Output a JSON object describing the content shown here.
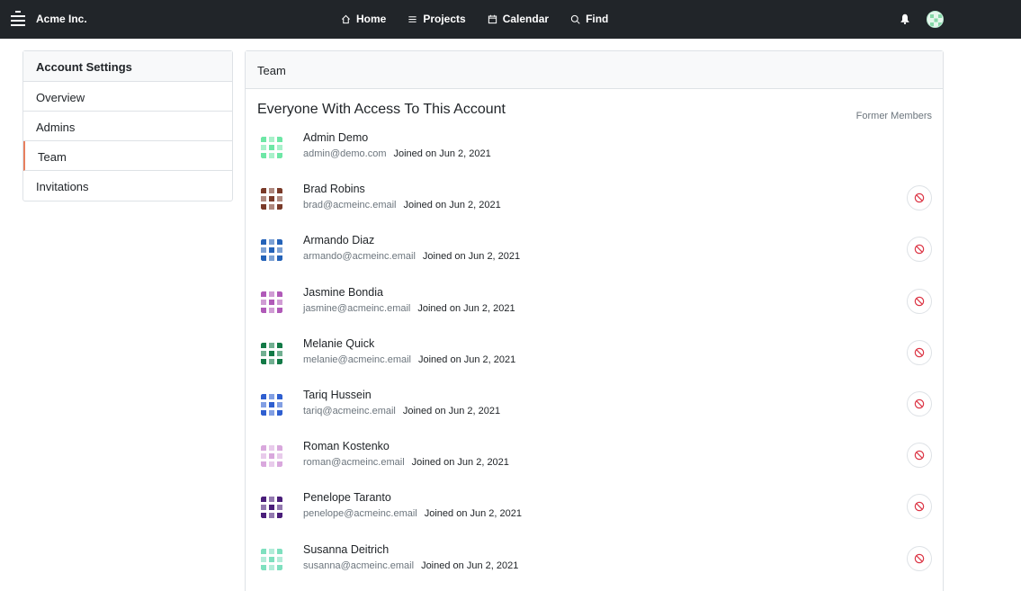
{
  "navbar": {
    "brand": "Acme Inc.",
    "links": [
      {
        "label": "Home",
        "icon": "home-icon"
      },
      {
        "label": "Projects",
        "icon": "list-icon"
      },
      {
        "label": "Calendar",
        "icon": "calendar-icon"
      },
      {
        "label": "Find",
        "icon": "search-icon"
      }
    ]
  },
  "sidebar": {
    "title": "Account Settings",
    "items": [
      {
        "label": "Overview"
      },
      {
        "label": "Admins"
      },
      {
        "label": "Team",
        "active": true
      },
      {
        "label": "Invitations"
      }
    ]
  },
  "main": {
    "card_title": "Team",
    "section_title": "Everyone With Access To This Account",
    "former_members_link": "Former Members",
    "members": [
      {
        "name": "Admin Demo",
        "email": "admin@demo.com",
        "joined": "Joined on Jun 2, 2021",
        "color": "#6ee7a6",
        "revocable": false
      },
      {
        "name": "Brad Robins",
        "email": "brad@acmeinc.email",
        "joined": "Joined on Jun 2, 2021",
        "color": "#7a3b2a",
        "revocable": true
      },
      {
        "name": "Armando Diaz",
        "email": "armando@acmeinc.email",
        "joined": "Joined on Jun 2, 2021",
        "color": "#2563b8",
        "revocable": true
      },
      {
        "name": "Jasmine Bondia",
        "email": "jasmine@acmeinc.email",
        "joined": "Joined on Jun 2, 2021",
        "color": "#b05ab8",
        "revocable": true
      },
      {
        "name": "Melanie Quick",
        "email": "melanie@acmeinc.email",
        "joined": "Joined on Jun 2, 2021",
        "color": "#137a47",
        "revocable": true
      },
      {
        "name": "Tariq Hussein",
        "email": "tariq@acmeinc.email",
        "joined": "Joined on Jun 2, 2021",
        "color": "#2f5fd0",
        "revocable": true
      },
      {
        "name": "Roman Kostenko",
        "email": "roman@acmeinc.email",
        "joined": "Joined on Jun 2, 2021",
        "color": "#d9a8dd",
        "revocable": true
      },
      {
        "name": "Penelope Taranto",
        "email": "penelope@acmeinc.email",
        "joined": "Joined on Jun 2, 2021",
        "color": "#4a1e7a",
        "revocable": true
      },
      {
        "name": "Susanna Deitrich",
        "email": "susanna@acmeinc.email",
        "joined": "Joined on Jun 2, 2021",
        "color": "#7fe0bf",
        "revocable": true
      }
    ]
  },
  "colors": {
    "navbar_bg": "#212529",
    "active_accent": "#e8805f",
    "revoke_icon": "#dc3545"
  }
}
